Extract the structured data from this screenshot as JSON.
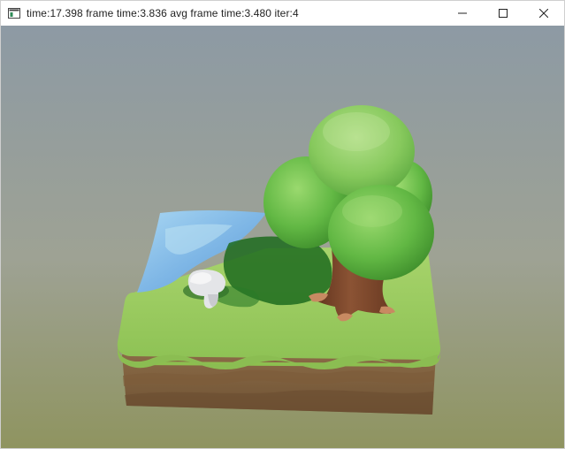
{
  "window": {
    "title": "time:17.398 frame time:3.836 avg frame time:3.480 iter:4",
    "controls": {
      "minimize": "minimize-icon",
      "maximize": "maximize-icon",
      "close": "close-icon"
    }
  },
  "scene": {
    "background_top": "#8e9aa3",
    "background_bottom": "#8f9560",
    "grass": "#a3d168",
    "dirt": "#7a5a3a",
    "water": "#8ec3e8",
    "tree_canopy": "#6cc24a",
    "trunk": "#7a4a2c",
    "rock": "#e6e6e8"
  }
}
